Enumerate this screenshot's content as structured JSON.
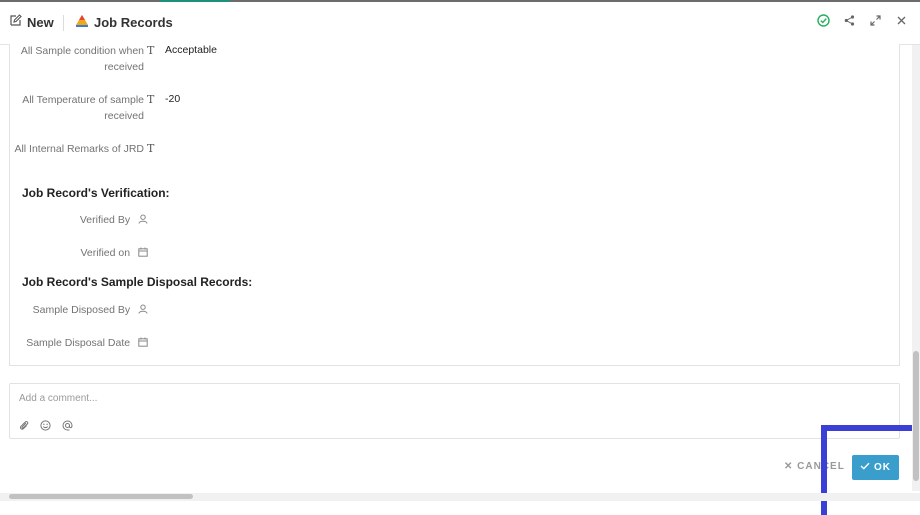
{
  "header": {
    "new_label": "New",
    "title": "Job Records",
    "icons": [
      "edit-icon",
      "app-logo-icon",
      "check-circle-icon",
      "share-icon",
      "expand-icon",
      "close-icon"
    ],
    "accent_color": "#27ae60"
  },
  "fields_top": [
    {
      "label": "All Sample condition when received",
      "value": "Acceptable"
    },
    {
      "label": "All Temperature of sample received",
      "value": "-20"
    },
    {
      "label": "All Internal Remarks of JRD",
      "value": ""
    }
  ],
  "sections": [
    {
      "title": "Job Record's Verification:",
      "fields": [
        {
          "label": "Verified By",
          "icon": "user-icon"
        },
        {
          "label": "Verified on",
          "icon": "calendar-icon"
        }
      ]
    },
    {
      "title": "Job Record's Sample Disposal Records:",
      "fields": [
        {
          "label": "Sample Disposed By",
          "icon": "user-icon"
        },
        {
          "label": "Sample Disposal Date",
          "icon": "calendar-icon"
        }
      ]
    }
  ],
  "comment": {
    "placeholder": "Add a comment...",
    "tools": [
      "attachment-icon",
      "emoji-icon",
      "mention-icon"
    ]
  },
  "footer": {
    "cancel_label": "CANCEL",
    "ok_label": "OK",
    "ok_color": "#3a9ecd",
    "highlight_color": "#3a3fd6"
  }
}
